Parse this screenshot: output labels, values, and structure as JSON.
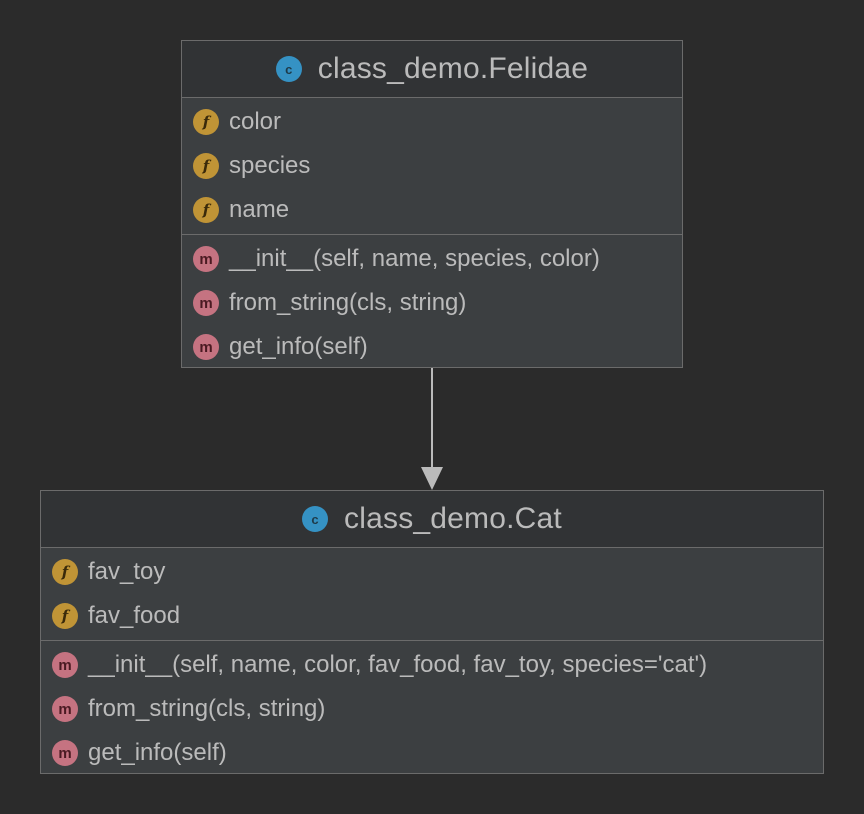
{
  "classes": [
    {
      "icon": "class-icon",
      "badge": "c",
      "name": "class_demo.Felidae",
      "fields": [
        {
          "badge": "f",
          "label": "color"
        },
        {
          "badge": "f",
          "label": "species"
        },
        {
          "badge": "f",
          "label": "name"
        }
      ],
      "methods": [
        {
          "badge": "m",
          "label": "__init__(self, name, species, color)"
        },
        {
          "badge": "m",
          "label": "from_string(cls, string)"
        },
        {
          "badge": "m",
          "label": "get_info(self)"
        }
      ]
    },
    {
      "icon": "class-icon",
      "badge": "c",
      "name": "class_demo.Cat",
      "fields": [
        {
          "badge": "f",
          "label": "fav_toy"
        },
        {
          "badge": "f",
          "label": "fav_food"
        }
      ],
      "methods": [
        {
          "badge": "m",
          "label": "__init__(self, name, color, fav_food, fav_toy, species='cat')"
        },
        {
          "badge": "m",
          "label": "from_string(cls, string)"
        },
        {
          "badge": "m",
          "label": "get_info(self)"
        }
      ]
    }
  ],
  "relations": [
    {
      "type": "inheritance",
      "from": "class_demo.Felidae",
      "to": "class_demo.Cat"
    }
  ],
  "colors": {
    "background": "#2b2b2b",
    "box": "#3c3f41",
    "header": "#313335",
    "class_badge": "#3592c4",
    "field_badge": "#c09436",
    "method_badge": "#c57381",
    "arrow": "#bbbbbb"
  }
}
